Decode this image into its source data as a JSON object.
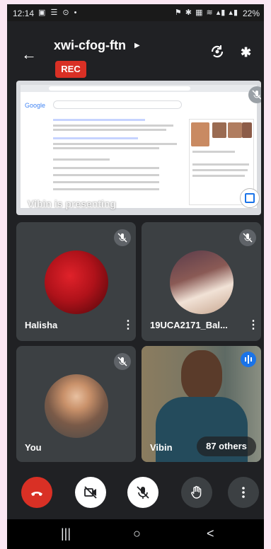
{
  "status_bar": {
    "time": "12:14",
    "left_icons": "▣ ☰ ⊙ •",
    "right_icons": "⚑ ✱ ▦ ≋ ▴▮ ▴▮",
    "battery": "22%"
  },
  "header": {
    "meeting_code": "xwi-cfog-ftn",
    "rec_label": "REC"
  },
  "presentation": {
    "presenter_label": "Vibin is presenting",
    "search_logo": "Google"
  },
  "participants": [
    {
      "name": "Halisha",
      "muted": true
    },
    {
      "name": "19UCA2171_Bal...",
      "muted": true
    },
    {
      "name": "You",
      "muted": true
    },
    {
      "name": "Vibin",
      "speaking": true,
      "others_label": "87 others"
    }
  ],
  "colors": {
    "end_call": "#d93025",
    "rec": "#d93025",
    "accent": "#1a73e8",
    "tile": "#3c4043",
    "background": "#202124"
  },
  "icons": {
    "back": "arrow-left",
    "switch_camera": "camera-rotate",
    "bluetooth": "bluetooth",
    "end_call": "phone-hangup",
    "camera": "camera-off",
    "mic": "mic-off",
    "raise_hand": "hand",
    "more": "more-vertical"
  },
  "nav": {
    "recents": "|||",
    "home": "○",
    "back": "<"
  }
}
